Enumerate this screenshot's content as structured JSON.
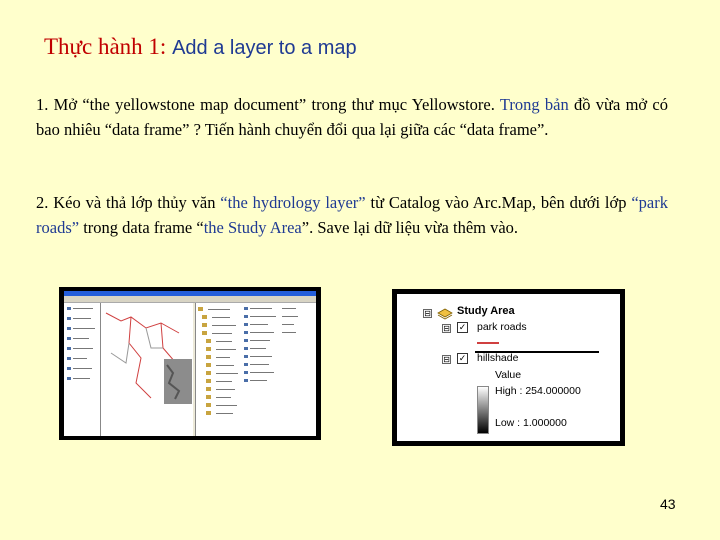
{
  "title": {
    "part1": "Thực hành 1:",
    "part2": "Add a layer  to a map"
  },
  "paragraph1": {
    "a": "1. Mở “the yellowstone map document” trong thư mục Yellowstore. ",
    "b": "Trong bản",
    "c": " đồ vừa mở có bao nhiêu “data frame” ? Tiến hành chuyển đổi qua lại giữa các “data frame”."
  },
  "paragraph2": {
    "a": "2. Kéo và thả lớp thủy văn ",
    "b": "“the hydrology layer”",
    "c": " từ Catalog vào Arc.Map, bên dưới lớp ",
    "d": "“park roads”",
    "e": " trong data frame “",
    "f": "the Study Area",
    "g": "”. Save lại dữ liệu vừa thêm vào."
  },
  "toc": {
    "dataframe": "Study Area",
    "layer1": "park roads",
    "layer2": "hillshade",
    "value_label": "Value",
    "high": "High : 254.000000",
    "low": "Low : 1.000000",
    "collapse": "⊟",
    "check": "✓"
  },
  "page_number": "43",
  "colors": {
    "background": "#ffffcc",
    "title_red": "#c00000",
    "blue_text": "#1f3a93"
  }
}
